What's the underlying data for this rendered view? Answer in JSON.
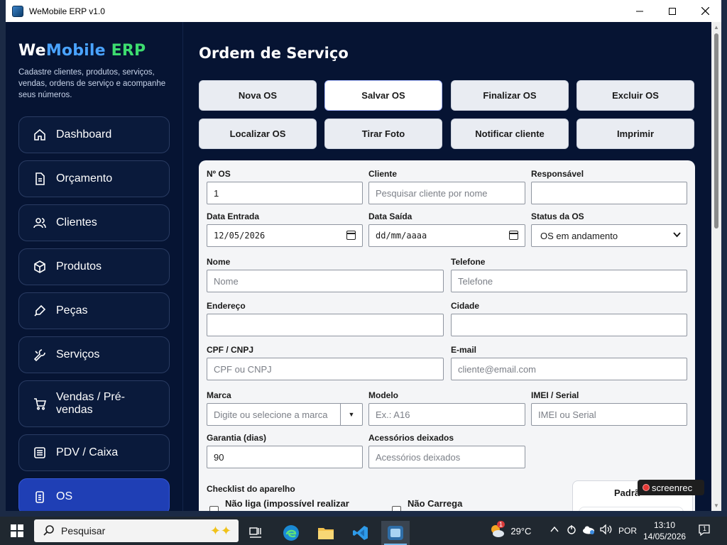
{
  "window": {
    "title": "WeMobile ERP v1.0",
    "controls": {
      "minimize": "—",
      "maximize": "☐",
      "close": "✕"
    }
  },
  "sidebar": {
    "logo": {
      "we": "We",
      "mobile": "Mobile",
      "erp": "ERP"
    },
    "tagline": "Cadastre clientes, produtos, serviços, vendas, ordens de serviço e acompanhe seus números.",
    "items": [
      {
        "label": "Dashboard",
        "icon": "home-icon"
      },
      {
        "label": "Orçamento",
        "icon": "document-icon"
      },
      {
        "label": "Clientes",
        "icon": "users-icon"
      },
      {
        "label": "Produtos",
        "icon": "box-icon"
      },
      {
        "label": "Peças",
        "icon": "tools-icon"
      },
      {
        "label": "Serviços",
        "icon": "wrench-icon"
      },
      {
        "label": "Vendas / Pré-vendas",
        "icon": "cart-icon"
      },
      {
        "label": "PDV / Caixa",
        "icon": "register-icon"
      },
      {
        "label": "OS",
        "icon": "clipboard-icon",
        "active": true
      }
    ]
  },
  "main": {
    "title": "Ordem de Serviço",
    "buttons": {
      "nova": "Nova OS",
      "salvar": "Salvar OS",
      "finalizar": "Finalizar OS",
      "excluir": "Excluir OS",
      "localizar": "Localizar OS",
      "foto": "Tirar Foto",
      "notificar": "Notificar cliente",
      "imprimir": "Imprimir"
    },
    "form": {
      "num_os": {
        "label": "Nº OS",
        "value": "1"
      },
      "cliente": {
        "label": "Cliente",
        "placeholder": "Pesquisar cliente por nome"
      },
      "responsavel": {
        "label": "Responsável",
        "value": ""
      },
      "data_entrada": {
        "label": "Data Entrada",
        "value": "12/05/2026"
      },
      "data_saida": {
        "label": "Data Saída",
        "placeholder": "dd/mm/aaaa"
      },
      "status": {
        "label": "Status da OS",
        "value": "OS em andamento"
      },
      "nome": {
        "label": "Nome",
        "placeholder": "Nome"
      },
      "telefone": {
        "label": "Telefone",
        "placeholder": "Telefone"
      },
      "endereco": {
        "label": "Endereço",
        "value": ""
      },
      "cidade": {
        "label": "Cidade",
        "value": ""
      },
      "cpf": {
        "label": "CPF / CNPJ",
        "placeholder": "CPF ou CNPJ"
      },
      "email": {
        "label": "E-mail",
        "placeholder": "cliente@email.com"
      },
      "marca": {
        "label": "Marca",
        "placeholder": "Digite ou selecione a marca"
      },
      "modelo": {
        "label": "Modelo",
        "placeholder": "Ex.: A16"
      },
      "imei": {
        "label": "IMEI / Serial",
        "placeholder": "IMEI ou Serial"
      },
      "garantia": {
        "label": "Garantia (dias)",
        "value": "90"
      },
      "acessorios": {
        "label": "Acessórios deixados",
        "placeholder": "Acessórios deixados"
      }
    },
    "checklist": {
      "title": "Checklist do aparelho",
      "items": [
        "Não liga (impossível realizar",
        "Não Carrega"
      ],
      "side_panel_title": "Padrã"
    }
  },
  "overlay": {
    "recorder": "screenrec"
  },
  "taskbar": {
    "search": "Pesquisar",
    "weather": "29°C",
    "weather_badge": "1",
    "language": "POR",
    "time": "13:10",
    "date": "14/05/2026",
    "notification_count": "1"
  }
}
